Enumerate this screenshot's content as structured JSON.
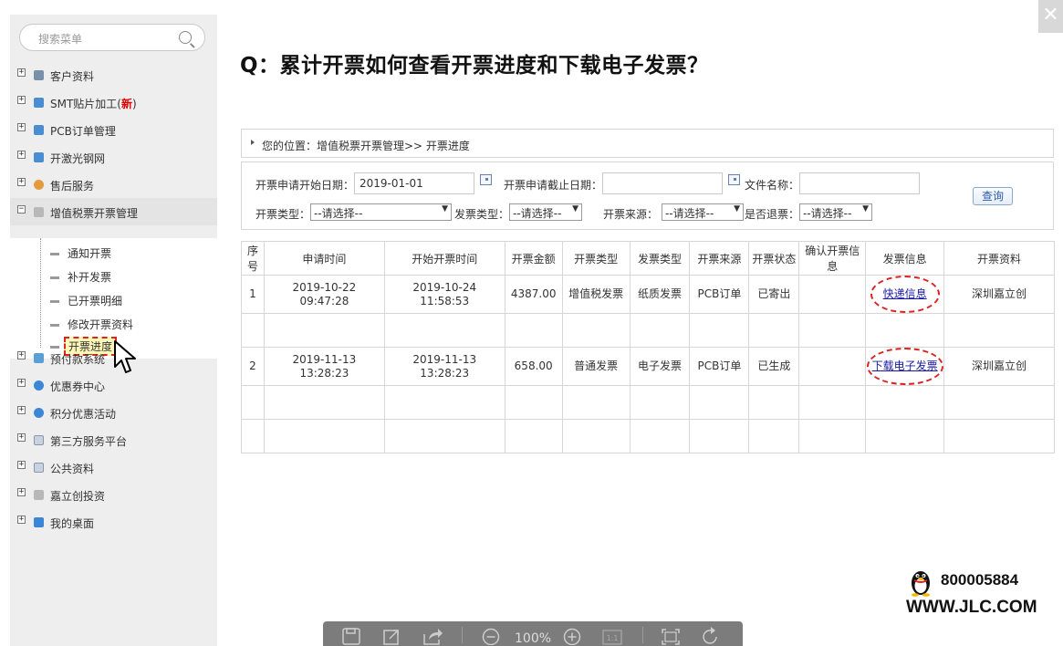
{
  "search": {
    "placeholder": "搜索菜单"
  },
  "menu": {
    "items": [
      {
        "label": "客户资料",
        "icon": "customer-icon"
      },
      {
        "label": "SMT贴片加工(",
        "badge": "新",
        "suffix": ")",
        "icon": "smt-icon"
      },
      {
        "label": "PCB订单管理",
        "icon": "pcb-icon"
      },
      {
        "label": "开激光钢网",
        "icon": "stencil-icon"
      },
      {
        "label": "售后服务",
        "icon": "service-icon"
      },
      {
        "label": "增值税票开票管理",
        "icon": "invoice-icon"
      }
    ],
    "sub_items": [
      {
        "label": "通知开票"
      },
      {
        "label": "补开发票"
      },
      {
        "label": "已开票明细"
      },
      {
        "label": "修改开票资料"
      },
      {
        "label": "开票进度"
      }
    ],
    "items_after": [
      {
        "label": "预付款系统",
        "icon": "prepay-icon"
      },
      {
        "label": "优惠券中心",
        "icon": "coupon-icon"
      },
      {
        "label": "积分优惠活动",
        "icon": "points-icon"
      },
      {
        "label": "第三方服务平台",
        "icon": "third-party-icon"
      },
      {
        "label": "公共资料",
        "icon": "public-icon"
      },
      {
        "label": "嘉立创投资",
        "icon": "invest-icon"
      },
      {
        "label": "我的桌面",
        "icon": "desktop-icon"
      }
    ]
  },
  "title": "Q：累计开票如何查看开票进度和下载电子发票？",
  "breadcrumb": "您的位置：增值税票开票管理>> 开票进度",
  "filter": {
    "start_label": "开票申请开始日期：",
    "start_value": "2019-01-01",
    "end_label": "开票申请截止日期：",
    "end_value": "",
    "file_label": "文件名称：",
    "file_value": "",
    "type_label": "开票类型：",
    "type_value": "--请选择--",
    "invoice_type_label": "发票类型：",
    "invoice_type_value": "--请选择--",
    "source_label": "开票来源：",
    "source_value": "--请选择--",
    "refund_label": "是否退票：",
    "refund_value": "--请选择--",
    "query_button": "查询"
  },
  "table": {
    "headers": [
      "序号",
      "申请时间",
      "开始开票时间",
      "开票金额",
      "开票类型",
      "发票类型",
      "开票来源",
      "开票状态",
      "确认开票信息",
      "发票信息",
      "开票资料"
    ],
    "rows": [
      {
        "no": "1",
        "apply_date": "2019-10-22",
        "apply_time": "09:47:28",
        "start_date": "2019-10-24",
        "start_time": "11:58:53",
        "amount": "4387.00",
        "type": "增值税发票",
        "invoice_type": "纸质发票",
        "source": "PCB订单",
        "status": "已寄出",
        "confirm": "",
        "info_link": "快递信息",
        "material": "深圳嘉立创"
      },
      {
        "no": "2",
        "apply_date": "2019-11-13",
        "apply_time": "13:28:23",
        "start_date": "2019-11-13",
        "start_time": "13:28:23",
        "amount": "658.00",
        "type": "普通发票",
        "invoice_type": "电子发票",
        "source": "PCB订单",
        "status": "已生成",
        "confirm": "",
        "info_link": "下载电子发票",
        "material": "深圳嘉立创"
      }
    ]
  },
  "contact": {
    "qq": "800005884",
    "site": "WWW.JLC.COM"
  },
  "toolbar": {
    "zoom": "100%"
  },
  "colors": {
    "accent_red": "#dd2222",
    "link": "#1a1aa8",
    "sidebar_bg": "#eeeeee"
  }
}
